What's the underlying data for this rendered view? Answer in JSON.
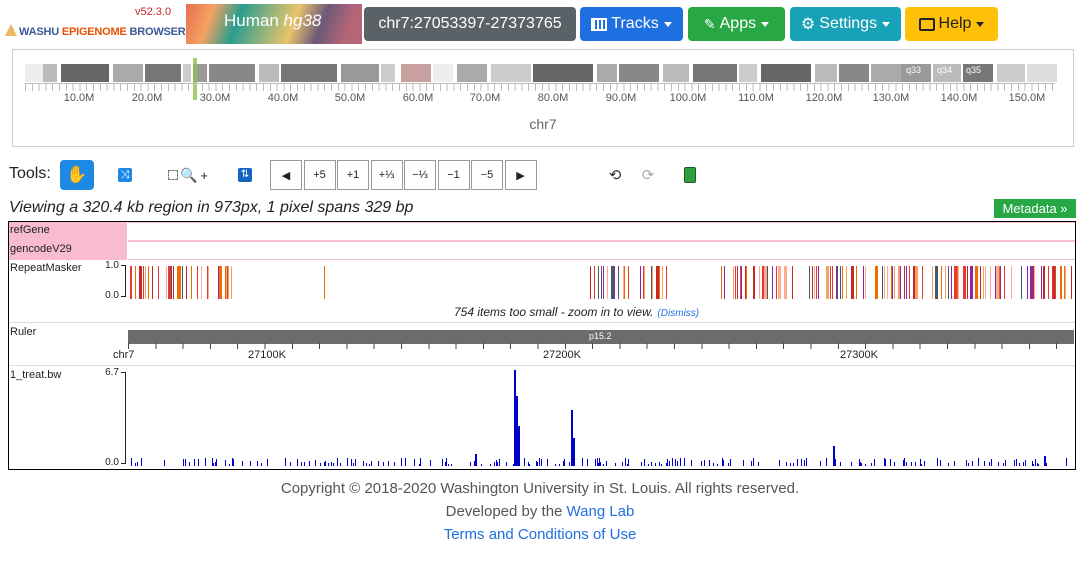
{
  "app": {
    "version": "v52.3.0",
    "brand_prefix": "Washu ",
    "brand_middle": "EpiGenome",
    "brand_suffix": " Browser",
    "genome_prefix": "Human ",
    "genome_assembly": "hg38"
  },
  "navbar": {
    "coordinates": "chr7:27053397-27373765",
    "tracks_label": "Tracks",
    "apps_label": "Apps",
    "settings_label": "Settings",
    "help_label": "Help"
  },
  "ideogram": {
    "chromosome": "chr7",
    "labels": [
      "10.0M",
      "20.0M",
      "30.0M",
      "40.0M",
      "50.0M",
      "60.0M",
      "70.0M",
      "80.0M",
      "90.0M",
      "100.0M",
      "110.0M",
      "120.0M",
      "130.0M",
      "140.0M",
      "150.0M"
    ],
    "band_labels": [
      "q33",
      "q34",
      "q35"
    ]
  },
  "toolbar": {
    "label": "Tools:",
    "zoom_in_plus": "+",
    "buttons": [
      "◀",
      "+5",
      "+1",
      "+⅓",
      "−⅓",
      "−1",
      "−5",
      "▶"
    ]
  },
  "info": {
    "viewing_text": "Viewing a 320.4 kb region in 973px, 1 pixel spans 329 bp",
    "metadata_label": "Metadata »"
  },
  "tracks": {
    "refgene_label": "refGene",
    "gencode_label": "gencodeV29",
    "repeatmasker_label": "RepeatMasker",
    "repeat_max": "1.0",
    "repeat_min": "0.0",
    "too_small_text": "754 items too small - zoom in to view.",
    "dismiss_label": "(Dismiss)",
    "ruler_label": "Ruler",
    "ruler_band": "p15.2",
    "ruler_chrom": "chr7",
    "ruler_ticks": [
      "27100K",
      "27200K",
      "27300K"
    ],
    "bigwig_label": "1_treat.bw",
    "bigwig_max": "6.7",
    "bigwig_min": "0.0",
    "signal_color": "#0000cc"
  },
  "footer": {
    "copyright": "Copyright © 2018-2020 Washington University in St. Louis. All rights reserved.",
    "developed_prefix": "Developed by the ",
    "lab_link": "Wang Lab",
    "terms_link": "Terms and Conditions of Use"
  }
}
